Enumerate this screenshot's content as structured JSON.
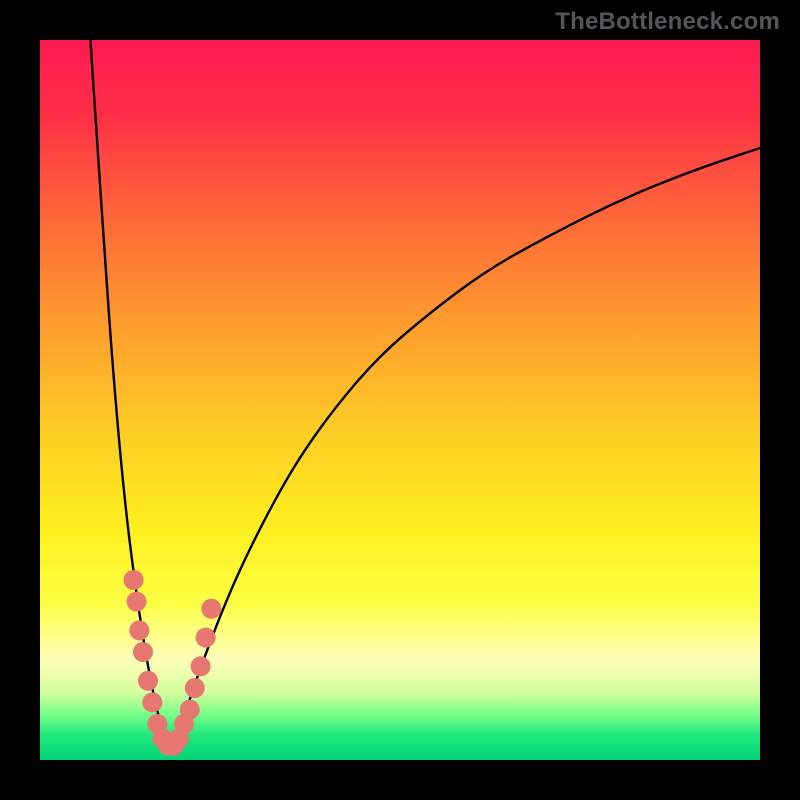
{
  "watermark": "TheBottleneck.com",
  "gradient": {
    "stops": [
      {
        "offset": 0.0,
        "color": "#ff1a52"
      },
      {
        "offset": 0.1,
        "color": "#ff2e47"
      },
      {
        "offset": 0.25,
        "color": "#fe6939"
      },
      {
        "offset": 0.4,
        "color": "#fe9e2e"
      },
      {
        "offset": 0.55,
        "color": "#fdcf25"
      },
      {
        "offset": 0.68,
        "color": "#fdf01f"
      },
      {
        "offset": 0.78,
        "color": "#fdff43"
      },
      {
        "offset": 0.86,
        "color": "#feffb8"
      },
      {
        "offset": 0.905,
        "color": "#d6ff9e"
      },
      {
        "offset": 0.935,
        "color": "#7dff88"
      },
      {
        "offset": 0.965,
        "color": "#22e97e"
      },
      {
        "offset": 1.0,
        "color": "#00d478"
      }
    ]
  },
  "chart_data": {
    "type": "line",
    "title": "",
    "xlabel": "",
    "ylabel": "",
    "xlim": [
      0,
      100
    ],
    "ylim": [
      0,
      100
    ],
    "grid": false,
    "legend_position": "none",
    "notes": "V-shaped bottleneck curve. x≈percent along horizontal axis, y≈percent vertical (0=top, 100=bottom). Minimum of curve near x≈18, where it dips to the green band near y≈100. Dots cluster around the minimum.",
    "series": [
      {
        "name": "curve-left",
        "x": [
          7,
          8,
          9,
          10,
          11,
          12,
          13,
          14,
          15,
          16,
          17,
          18
        ],
        "y": [
          0,
          15,
          30,
          44,
          56,
          66,
          74,
          81,
          87,
          92,
          96,
          99
        ]
      },
      {
        "name": "curve-right",
        "x": [
          18,
          20,
          22,
          25,
          28,
          32,
          36,
          41,
          47,
          54,
          62,
          71,
          81,
          91,
          100
        ],
        "y": [
          99,
          94,
          88,
          80,
          73,
          65,
          58,
          51,
          44,
          38,
          32,
          27,
          22,
          18,
          15
        ]
      },
      {
        "name": "dots",
        "type": "scatter",
        "color": "#e77771",
        "x": [
          13.0,
          13.4,
          13.8,
          14.3,
          15.0,
          15.6,
          16.3,
          17.0,
          17.8,
          18.6,
          19.3,
          20.0,
          20.8,
          21.5,
          22.3,
          23.0,
          23.8
        ],
        "y": [
          75,
          78,
          82,
          85,
          89,
          92,
          95,
          97,
          98,
          98,
          97,
          95,
          93,
          90,
          87,
          83,
          79
        ]
      }
    ]
  }
}
